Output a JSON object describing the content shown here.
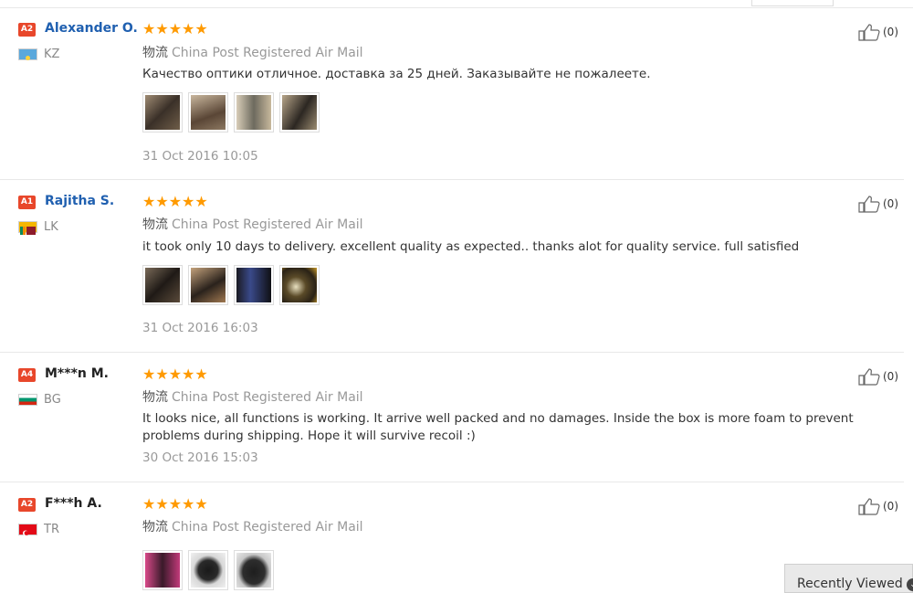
{
  "shipping_glyph": "物流",
  "reviews": [
    {
      "badge": "A2",
      "name": "Alexander O.",
      "country": "KZ",
      "stars": "★★★★★",
      "shipping": "China Post Registered Air Mail",
      "text": "Качество оптики отличное. доставка за 25 дней. Заказывайте не пожалеете.",
      "date": "31 Oct 2016 10:05",
      "likes": "(0)",
      "photo_count": 4
    },
    {
      "badge": "A1",
      "name": "Rajitha S.",
      "country": "LK",
      "stars": "★★★★★",
      "shipping": "China Post Registered Air Mail",
      "text": "it took only 10 days to delivery. excellent quality as expected.. thanks alot for quality service. full satisfied",
      "date": "31 Oct 2016 16:03",
      "likes": "(0)",
      "photo_count": 4
    },
    {
      "badge": "A4",
      "name": "M***n M.",
      "country": "BG",
      "stars": "★★★★★",
      "shipping": "China Post Registered Air Mail",
      "text": "It looks nice, all functions is working. It arrive well packed and no damages. Inside the box is more foam to prevent problems during shipping. Hope it will survive recoil :)",
      "date": "30 Oct 2016 15:03",
      "likes": "(0)",
      "photo_count": 0
    },
    {
      "badge": "A2",
      "name": "F***h A.",
      "country": "TR",
      "stars": "★★★★★",
      "shipping": "China Post Registered Air Mail",
      "text": "",
      "date": "",
      "likes": "(0)",
      "photo_count": 3
    }
  ],
  "recently_viewed": {
    "label": "Recently Viewed",
    "icon": "chevron-icon"
  },
  "colors": {
    "badge": "#e8472b",
    "name_link": "#2060b0",
    "stars": "#ff9a00"
  }
}
